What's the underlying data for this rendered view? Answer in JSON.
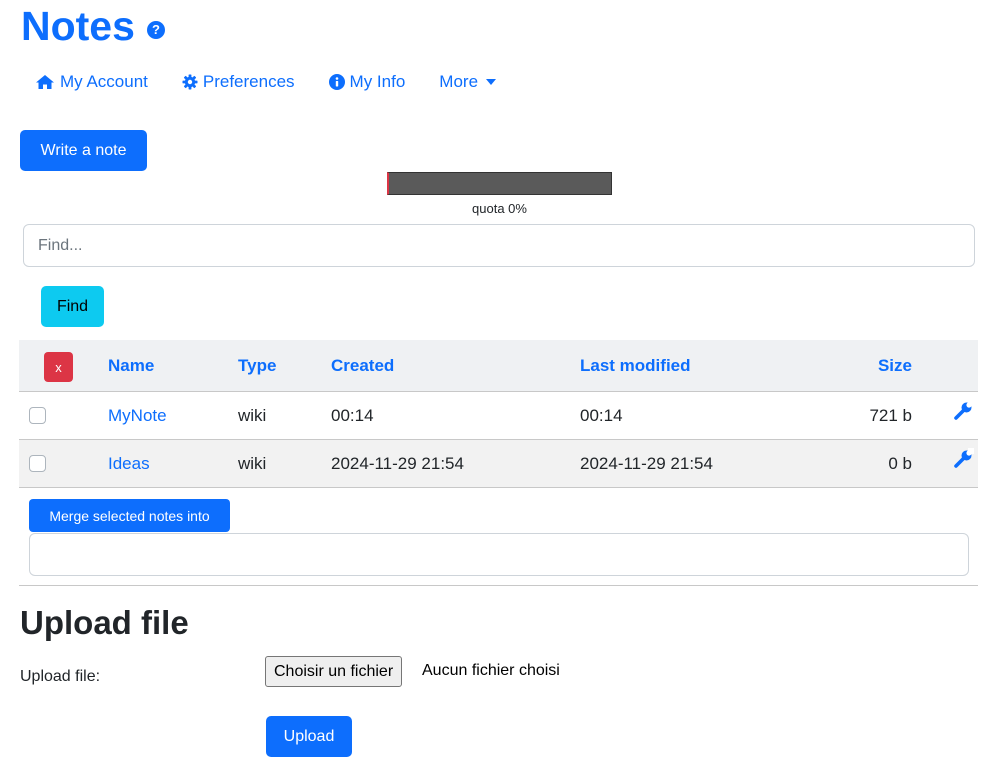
{
  "page": {
    "title": "Notes",
    "help_icon": "?"
  },
  "nav": {
    "account": "My Account",
    "preferences": "Preferences",
    "info": "My Info",
    "more": "More"
  },
  "write_note_label": "Write a note",
  "quota": {
    "label": "quota 0%",
    "value_percent": 0
  },
  "search": {
    "placeholder": "Find...",
    "value": "",
    "button_label": "Find"
  },
  "table": {
    "clear_label": "x",
    "headers": {
      "name": "Name",
      "type": "Type",
      "created": "Created",
      "modified": "Last modified",
      "size": "Size"
    },
    "rows": [
      {
        "name": "MyNote",
        "type": "wiki",
        "created": "00:14",
        "modified": "00:14",
        "size": "721 b"
      },
      {
        "name": "Ideas",
        "type": "wiki",
        "created": "2024-11-29 21:54",
        "modified": "2024-11-29 21:54",
        "size": "0 b"
      }
    ]
  },
  "merge": {
    "button_label": "Merge selected notes into",
    "value": ""
  },
  "upload": {
    "heading": "Upload file",
    "label": "Upload file:",
    "choose_label": "Choisir un fichier",
    "no_file": "Aucun fichier choisi",
    "submit_label": "Upload"
  },
  "colors": {
    "primary": "#0d6efd",
    "info": "#0dcaf0",
    "danger": "#dc3545"
  }
}
